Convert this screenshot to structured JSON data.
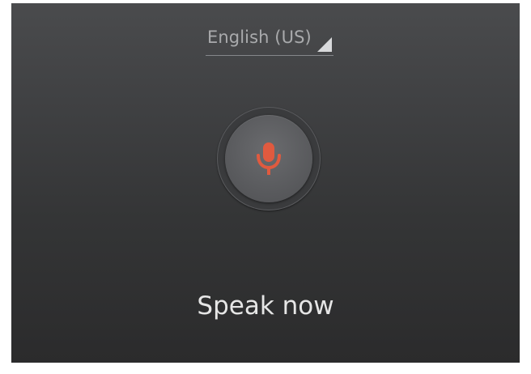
{
  "language_selector": {
    "label": "English (US)"
  },
  "mic": {
    "icon": "microphone-icon",
    "color": "#e05a3f"
  },
  "prompt": {
    "text": "Speak now"
  }
}
